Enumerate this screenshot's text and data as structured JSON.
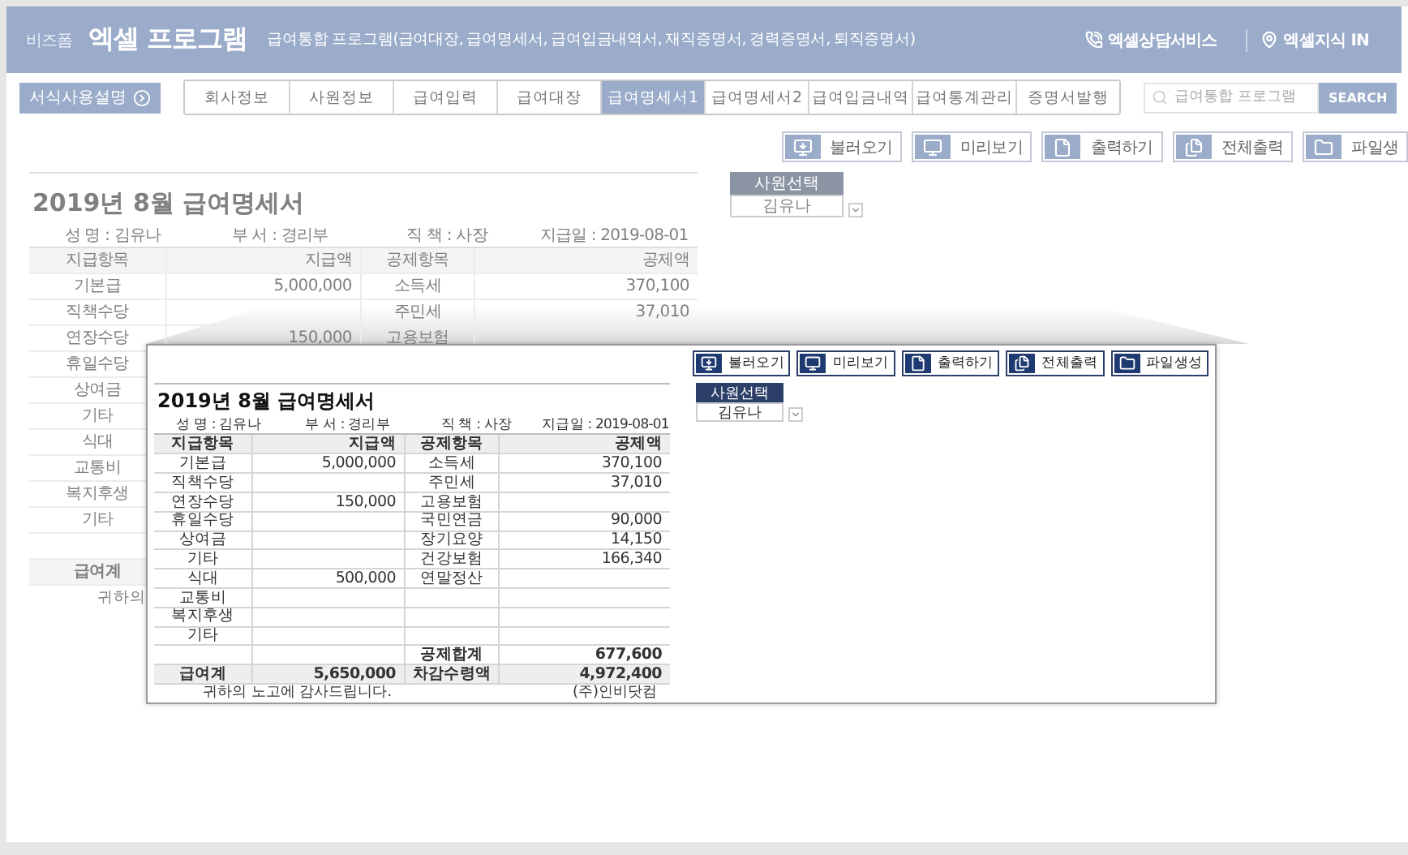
{
  "header": {
    "brand_small": "비즈폼",
    "brand": "엑셀 프로그램",
    "subtitle": "급여통합 프로그램(급여대장, 급여명세서, 급여입금내역서, 재직증명서, 경력증명서, 퇴직증명서)",
    "links": [
      {
        "kind": "phone",
        "label": "엑셀상담서비스"
      },
      {
        "kind": "pin",
        "label": "엑셀지식 IN"
      }
    ]
  },
  "guide_button": "서식사용설명",
  "tabs": [
    {
      "label": "회사정보",
      "selected": false
    },
    {
      "label": "사원정보",
      "selected": false
    },
    {
      "label": "급여입력",
      "selected": false
    },
    {
      "label": "급여대장",
      "selected": false
    },
    {
      "label": "급여명세서1",
      "selected": true
    },
    {
      "label": "급여명세서2",
      "selected": false
    },
    {
      "label": "급여입금내역",
      "selected": false
    },
    {
      "label": "급여통계관리",
      "selected": false
    },
    {
      "label": "증명서발행",
      "selected": false
    }
  ],
  "search": {
    "placeholder": "급여통합 프로그램",
    "button": "SEARCH"
  },
  "background": {
    "toolbar": [
      {
        "kind": "load",
        "label": "불러오기"
      },
      {
        "kind": "preview",
        "label": "미리보기"
      },
      {
        "kind": "print",
        "label": "출력하기"
      },
      {
        "kind": "print_all",
        "label": "전체출력"
      },
      {
        "kind": "file",
        "label": "파일생"
      }
    ],
    "sheet": {
      "title": "2019년 8월 급여명세서",
      "info": [
        {
          "label": "성 명 :",
          "value": "김유나"
        },
        {
          "label": "부 서 :",
          "value": "경리부"
        },
        {
          "label": "직 책 :",
          "value": "사장"
        },
        {
          "label": "지급일 :",
          "value": "2019-08-01"
        }
      ],
      "columns": [
        "지급항목",
        "지급액",
        "공제항목",
        "공제액"
      ],
      "rows": [
        {
          "kind": "item",
          "item": "기본급",
          "pay": "5,000,000",
          "deduction_item": "소득세",
          "deduction": "370,100"
        },
        {
          "kind": "item",
          "item": "직책수당",
          "deduction_item": "주민세",
          "deduction": "37,010"
        },
        {
          "kind": "item",
          "item": "연장수당",
          "pay": "150,000",
          "deduction_item": "고용보험"
        },
        {
          "kind": "item",
          "item": "휴일수당"
        },
        {
          "kind": "item",
          "item": "상여금"
        },
        {
          "kind": "item",
          "item": "기타"
        },
        {
          "kind": "item",
          "item": "식대"
        },
        {
          "kind": "item",
          "item": "교통비"
        },
        {
          "kind": "item",
          "item": "복지후생"
        },
        {
          "kind": "item",
          "item": "기타"
        },
        {
          "kind": "sum"
        },
        {
          "kind": "total",
          "item": "급여계"
        }
      ],
      "footer": {
        "thanks": "귀하의"
      }
    },
    "employee_select": {
      "header": "사원선택",
      "value": "김유나"
    }
  },
  "popup": {
    "toolbar": [
      {
        "kind": "load",
        "label": "불러오기"
      },
      {
        "kind": "preview",
        "label": "미리보기"
      },
      {
        "kind": "print",
        "label": "출력하기"
      },
      {
        "kind": "print_all",
        "label": "전체출력"
      },
      {
        "kind": "file",
        "label": "파일생성"
      }
    ],
    "sheet": {
      "title": "2019년 8월 급여명세서",
      "info": [
        {
          "label": "성 명 :",
          "value": "김유나"
        },
        {
          "label": "부 서 :",
          "value": "경리부"
        },
        {
          "label": "직 책 :",
          "value": "사장"
        },
        {
          "label": "지급일 :",
          "value": "2019-08-01"
        }
      ],
      "columns": [
        "지급항목",
        "지급액",
        "공제항목",
        "공제액"
      ],
      "rows": [
        {
          "kind": "item",
          "item": "기본급",
          "pay": "5,000,000",
          "deduction_item": "소득세",
          "deduction": "370,100"
        },
        {
          "kind": "item",
          "item": "직책수당",
          "deduction_item": "주민세",
          "deduction": "37,010"
        },
        {
          "kind": "item",
          "item": "연장수당",
          "pay": "150,000",
          "deduction_item": "고용보험"
        },
        {
          "kind": "item",
          "item": "휴일수당",
          "deduction_item": "국민연금",
          "deduction": "90,000"
        },
        {
          "kind": "item",
          "item": "상여금",
          "deduction_item": "장기요양",
          "deduction": "14,150"
        },
        {
          "kind": "item",
          "item": "기타",
          "deduction_item": "건강보험",
          "deduction": "166,340"
        },
        {
          "kind": "item",
          "item": "식대",
          "pay": "500,000",
          "deduction_item": "연말정산"
        },
        {
          "kind": "item",
          "item": "교통비"
        },
        {
          "kind": "item",
          "item": "복지후생"
        },
        {
          "kind": "item",
          "item": "기타"
        },
        {
          "kind": "sum",
          "deduction_item": "공제합계",
          "deduction": "677,600"
        },
        {
          "kind": "total",
          "item": "급여계",
          "pay": "5,650,000",
          "deduction_item": "차감수령액",
          "deduction": "4,972,400"
        }
      ],
      "footer": {
        "thanks": "귀하의 노고에 감사드립니다.",
        "company": "(주)인비닷컴"
      }
    },
    "employee_select": {
      "header": "사원선택",
      "value": "김유나"
    }
  }
}
